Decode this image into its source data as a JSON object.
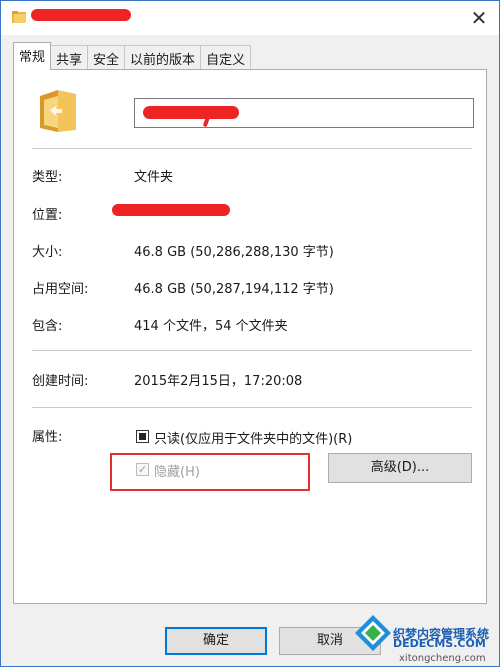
{
  "window": {
    "title": "",
    "close_glyph": "✕",
    "icons": {
      "title": "folder-icon",
      "close": "close-icon"
    }
  },
  "tabs": [
    {
      "label": "常规",
      "active": true
    },
    {
      "label": "共享",
      "active": false
    },
    {
      "label": "安全",
      "active": false
    },
    {
      "label": "以前的版本",
      "active": false
    },
    {
      "label": "自定义",
      "active": false
    }
  ],
  "general": {
    "folder_name": "",
    "type_label": "类型:",
    "type_value": "文件夹",
    "location_label": "位置:",
    "location_value": "",
    "size_label": "大小:",
    "size_value": "46.8 GB (50,286,288,130 字节)",
    "disk_size_label": "占用空间:",
    "disk_size_value": "46.8 GB (50,287,194,112 字节)",
    "contains_label": "包含:",
    "contains_value": "414 个文件，54 个文件夹",
    "created_label": "创建时间:",
    "created_value": "2015年2月15日，17:20:08",
    "attributes_label": "属性:",
    "readonly_label": "只读(仅应用于文件夹中的文件)(R)",
    "hidden_label": "隐藏(H)",
    "advanced_button": "高级(D)..."
  },
  "buttons": {
    "ok": "确定",
    "cancel": "取消"
  },
  "watermark": {
    "line1": "织梦内容管理系统",
    "line2": "DEDECMS.COM",
    "line3": "xitongcheng.com"
  },
  "colors": {
    "accent": "#0078d7",
    "highlight": "#e03030",
    "redaction": "#ee2424"
  }
}
